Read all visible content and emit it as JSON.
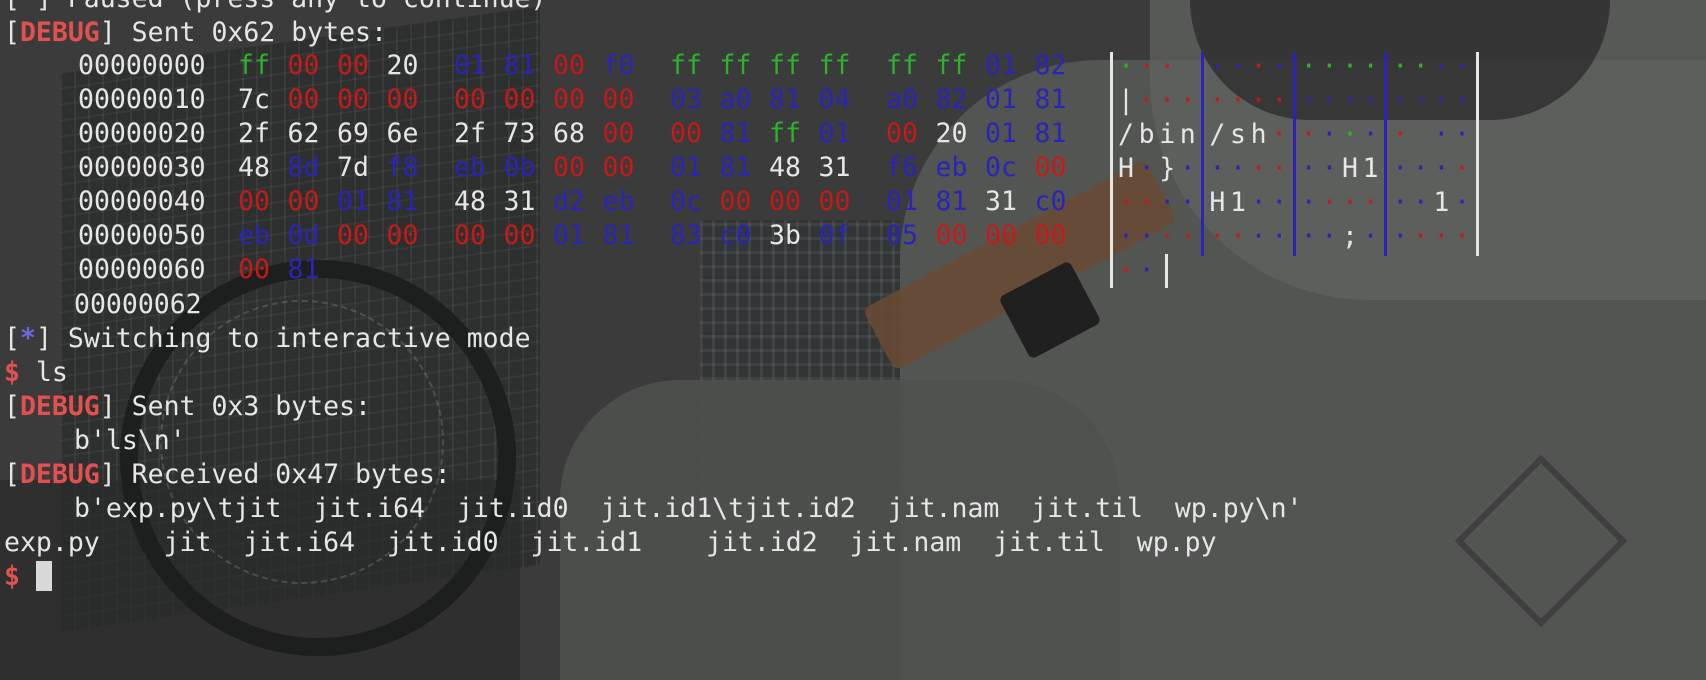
{
  "top_partial": "[*] Paused (press any to continue)",
  "lines": {
    "debug_sent_1": {
      "bracket_open": "[",
      "tag": "DEBUG",
      "bracket_close": "]",
      "text": " Sent 0x62 bytes:"
    },
    "switch": {
      "bracket_open": "[",
      "tag": "*",
      "bracket_close": "]",
      "text": " Switching to interactive mode"
    },
    "cmd_ls": {
      "prompt": "$",
      "text": " ls"
    },
    "debug_sent_2": {
      "bracket_open": "[",
      "tag": "DEBUG",
      "bracket_close": "]",
      "text": " Sent 0x3 bytes:"
    },
    "sent_2_payload": "b'ls\\n'",
    "debug_recv": {
      "bracket_open": "[",
      "tag": "DEBUG",
      "bracket_close": "]",
      "text": " Received 0x47 bytes:"
    },
    "recv_payload": "b'exp.py\\tjit  jit.i64  jit.id0  jit.id1\\tjit.id2  jit.nam  jit.til  wp.py\\n'",
    "ls_output": "exp.py    jit  jit.i64  jit.id0  jit.id1    jit.id2  jit.nam  jit.til  wp.py",
    "final_prompt": "$"
  },
  "hexdump": {
    "offsets": [
      "00000000",
      "00000010",
      "00000020",
      "00000030",
      "00000040",
      "00000050",
      "00000060",
      "00000062"
    ],
    "rows": [
      [
        [
          "ff",
          "g"
        ],
        [
          "00",
          "r"
        ],
        [
          "00",
          "r"
        ],
        [
          "20",
          "w"
        ],
        [
          "01",
          "b"
        ],
        [
          "81",
          "b"
        ],
        [
          "00",
          "r"
        ],
        [
          "f0",
          "b"
        ],
        [
          "ff",
          "g"
        ],
        [
          "ff",
          "g"
        ],
        [
          "ff",
          "g"
        ],
        [
          "ff",
          "g"
        ],
        [
          "ff",
          "g"
        ],
        [
          "ff",
          "g"
        ],
        [
          "01",
          "b"
        ],
        [
          "82",
          "b"
        ]
      ],
      [
        [
          "7c",
          "w"
        ],
        [
          "00",
          "r"
        ],
        [
          "00",
          "r"
        ],
        [
          "00",
          "r"
        ],
        [
          "00",
          "r"
        ],
        [
          "00",
          "r"
        ],
        [
          "00",
          "r"
        ],
        [
          "00",
          "r"
        ],
        [
          "03",
          "b"
        ],
        [
          "a0",
          "b"
        ],
        [
          "81",
          "b"
        ],
        [
          "04",
          "b"
        ],
        [
          "a0",
          "b"
        ],
        [
          "82",
          "b"
        ],
        [
          "01",
          "b"
        ],
        [
          "81",
          "b"
        ]
      ],
      [
        [
          "2f",
          "w"
        ],
        [
          "62",
          "w"
        ],
        [
          "69",
          "w"
        ],
        [
          "6e",
          "w"
        ],
        [
          "2f",
          "w"
        ],
        [
          "73",
          "w"
        ],
        [
          "68",
          "w"
        ],
        [
          "00",
          "r"
        ],
        [
          "00",
          "r"
        ],
        [
          "81",
          "b"
        ],
        [
          "ff",
          "g"
        ],
        [
          "01",
          "b"
        ],
        [
          "00",
          "r"
        ],
        [
          "20",
          "w"
        ],
        [
          "01",
          "b"
        ],
        [
          "81",
          "b"
        ]
      ],
      [
        [
          "48",
          "w"
        ],
        [
          "8d",
          "b"
        ],
        [
          "7d",
          "w"
        ],
        [
          "f8",
          "b"
        ],
        [
          "eb",
          "b"
        ],
        [
          "0b",
          "b"
        ],
        [
          "00",
          "r"
        ],
        [
          "00",
          "r"
        ],
        [
          "01",
          "b"
        ],
        [
          "81",
          "b"
        ],
        [
          "48",
          "w"
        ],
        [
          "31",
          "w"
        ],
        [
          "f6",
          "b"
        ],
        [
          "eb",
          "b"
        ],
        [
          "0c",
          "b"
        ],
        [
          "00",
          "r"
        ]
      ],
      [
        [
          "00",
          "r"
        ],
        [
          "00",
          "r"
        ],
        [
          "01",
          "b"
        ],
        [
          "81",
          "b"
        ],
        [
          "48",
          "w"
        ],
        [
          "31",
          "w"
        ],
        [
          "d2",
          "b"
        ],
        [
          "eb",
          "b"
        ],
        [
          "0c",
          "b"
        ],
        [
          "00",
          "r"
        ],
        [
          "00",
          "r"
        ],
        [
          "00",
          "r"
        ],
        [
          "01",
          "b"
        ],
        [
          "81",
          "b"
        ],
        [
          "31",
          "w"
        ],
        [
          "c0",
          "b"
        ]
      ],
      [
        [
          "eb",
          "b"
        ],
        [
          "0d",
          "b"
        ],
        [
          "00",
          "r"
        ],
        [
          "00",
          "r"
        ],
        [
          "00",
          "r"
        ],
        [
          "00",
          "r"
        ],
        [
          "01",
          "b"
        ],
        [
          "81",
          "b"
        ],
        [
          "83",
          "b"
        ],
        [
          "c0",
          "b"
        ],
        [
          "3b",
          "w"
        ],
        [
          "0f",
          "b"
        ],
        [
          "05",
          "b"
        ],
        [
          "00",
          "r"
        ],
        [
          "00",
          "r"
        ],
        [
          "00",
          "r"
        ]
      ],
      [
        [
          "00",
          "r"
        ],
        [
          "81",
          "b"
        ]
      ]
    ],
    "ascii": [
      [
        [
          "·",
          "g"
        ],
        [
          "·",
          "r"
        ],
        [
          "·",
          "r"
        ],
        [
          " ",
          "w"
        ],
        [
          "·",
          "b"
        ],
        [
          "·",
          "b"
        ],
        [
          "·",
          "r"
        ],
        [
          "·",
          "b"
        ],
        [
          "·",
          "g"
        ],
        [
          "·",
          "g"
        ],
        [
          "·",
          "g"
        ],
        [
          "·",
          "g"
        ],
        [
          "·",
          "g"
        ],
        [
          "·",
          "g"
        ],
        [
          "·",
          "b"
        ],
        [
          "·",
          "b"
        ]
      ],
      [
        [
          "|",
          "w"
        ],
        [
          "·",
          "r"
        ],
        [
          "·",
          "r"
        ],
        [
          "·",
          "r"
        ],
        [
          "·",
          "r"
        ],
        [
          "·",
          "r"
        ],
        [
          "·",
          "r"
        ],
        [
          "·",
          "r"
        ],
        [
          "·",
          "b"
        ],
        [
          "·",
          "b"
        ],
        [
          "·",
          "b"
        ],
        [
          "·",
          "b"
        ],
        [
          "·",
          "b"
        ],
        [
          "·",
          "b"
        ],
        [
          "·",
          "b"
        ],
        [
          "·",
          "b"
        ]
      ],
      [
        [
          "/",
          "w"
        ],
        [
          "b",
          "w"
        ],
        [
          "i",
          "w"
        ],
        [
          "n",
          "w"
        ],
        [
          "/",
          "w"
        ],
        [
          "s",
          "w"
        ],
        [
          "h",
          "w"
        ],
        [
          "·",
          "r"
        ],
        [
          "·",
          "r"
        ],
        [
          "·",
          "b"
        ],
        [
          "·",
          "g"
        ],
        [
          "·",
          "b"
        ],
        [
          "·",
          "r"
        ],
        [
          " ",
          "w"
        ],
        [
          "·",
          "b"
        ],
        [
          "·",
          "b"
        ]
      ],
      [
        [
          "H",
          "w"
        ],
        [
          "·",
          "b"
        ],
        [
          "}",
          "w"
        ],
        [
          "·",
          "b"
        ],
        [
          "·",
          "b"
        ],
        [
          "·",
          "b"
        ],
        [
          "·",
          "r"
        ],
        [
          "·",
          "r"
        ],
        [
          "·",
          "b"
        ],
        [
          "·",
          "b"
        ],
        [
          "H",
          "w"
        ],
        [
          "1",
          "w"
        ],
        [
          "·",
          "b"
        ],
        [
          "·",
          "b"
        ],
        [
          "·",
          "b"
        ],
        [
          "·",
          "r"
        ]
      ],
      [
        [
          "·",
          "r"
        ],
        [
          "·",
          "r"
        ],
        [
          "·",
          "b"
        ],
        [
          "·",
          "b"
        ],
        [
          "H",
          "w"
        ],
        [
          "1",
          "w"
        ],
        [
          "·",
          "b"
        ],
        [
          "·",
          "b"
        ],
        [
          "·",
          "b"
        ],
        [
          "·",
          "r"
        ],
        [
          "·",
          "r"
        ],
        [
          "·",
          "r"
        ],
        [
          "·",
          "b"
        ],
        [
          "·",
          "b"
        ],
        [
          "1",
          "w"
        ],
        [
          "·",
          "b"
        ]
      ],
      [
        [
          "·",
          "b"
        ],
        [
          "·",
          "b"
        ],
        [
          "·",
          "r"
        ],
        [
          "·",
          "r"
        ],
        [
          "·",
          "r"
        ],
        [
          "·",
          "r"
        ],
        [
          "·",
          "b"
        ],
        [
          "·",
          "b"
        ],
        [
          "·",
          "b"
        ],
        [
          "·",
          "b"
        ],
        [
          ";",
          "w"
        ],
        [
          "·",
          "b"
        ],
        [
          "·",
          "b"
        ],
        [
          "·",
          "r"
        ],
        [
          "·",
          "r"
        ],
        [
          "·",
          "r"
        ]
      ],
      [
        [
          "·",
          "r"
        ],
        [
          "·",
          "b"
        ]
      ]
    ]
  },
  "colors": {
    "white": "#e6e6e6",
    "red": "#c61a1a",
    "blue": "#2b24b8",
    "green": "#2fb12f",
    "debug": "#e45050",
    "star": "#6a6ae8"
  }
}
